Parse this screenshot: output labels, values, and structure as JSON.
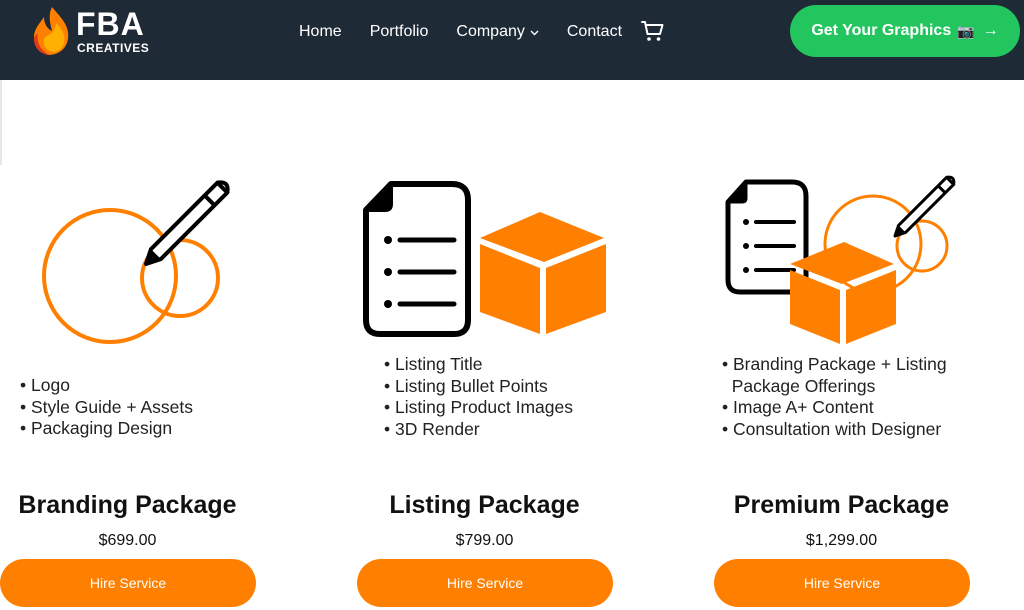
{
  "brand": {
    "name": "FBA",
    "tagline": "CREATIVES"
  },
  "nav": {
    "items": [
      {
        "label": "Home"
      },
      {
        "label": "Portfolio"
      },
      {
        "label": "Company"
      },
      {
        "label": "Contact"
      }
    ]
  },
  "cta": {
    "label": "Get Your Graphics",
    "camera": "📷",
    "arrow": "→"
  },
  "colors": {
    "header": "#1f2a37",
    "accent": "#ff8000",
    "cta": "#22c55e"
  },
  "packages": [
    {
      "title": "Branding Package",
      "price": "$699.00",
      "button": "Hire Service",
      "features": [
        "Logo",
        "Style Guide + Assets",
        "Packaging Design"
      ]
    },
    {
      "title": "Listing Package",
      "price": "$799.00",
      "button": "Hire Service",
      "features": [
        "Listing Title",
        "Listing Bullet Points",
        "Listing Product Images",
        "3D Render"
      ]
    },
    {
      "title": "Premium Package",
      "price": "$1,299.00",
      "button": "Hire Service",
      "features": [
        "Branding Package + Listing",
        "Package Offerings",
        "Image A+ Content",
        "Consultation with Designer"
      ]
    }
  ]
}
